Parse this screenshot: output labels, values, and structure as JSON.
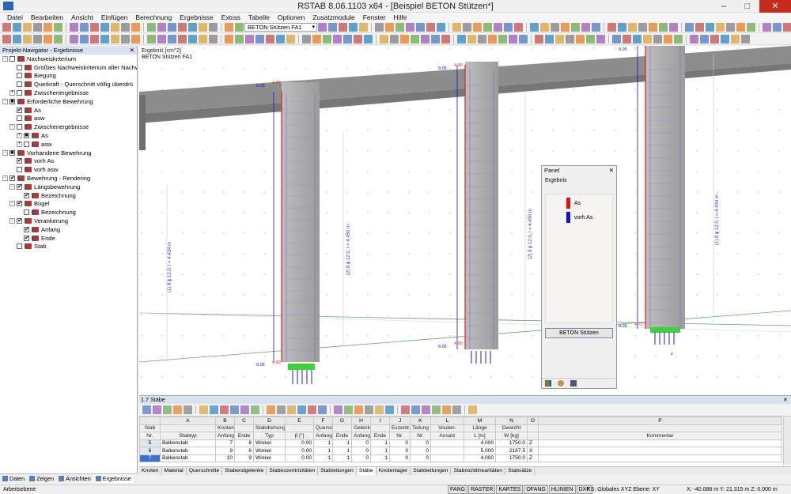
{
  "window": {
    "title": "RSTAB 8.06.1103 x64 - [Beispiel BETON Stützen*]",
    "min": "–",
    "max": "□",
    "close": "✕"
  },
  "menu": [
    "Datei",
    "Bearbeiten",
    "Ansicht",
    "Einfügen",
    "Berechnung",
    "Ergebnisse",
    "Extras",
    "Tabelle",
    "Optionen",
    "Zusatzmodule",
    "Fenster",
    "Hilfe"
  ],
  "toolbar": {
    "case_combo": "BETON Stützen FA1"
  },
  "navigator": {
    "title": "Projekt-Navigator - Ergebnisse",
    "close": "✕",
    "items": [
      {
        "label": "Nachweiskriterium",
        "level": 0,
        "expand": "-",
        "check": "",
        "icon": true
      },
      {
        "label": "Größtes Nachweiskriterium aller Nachw",
        "level": 1,
        "expand": "",
        "check": "",
        "icon": true
      },
      {
        "label": "Biegung",
        "level": 1,
        "expand": "",
        "check": "",
        "icon": true
      },
      {
        "label": "Querkraft - Querschnitt völlig überdrü",
        "level": 1,
        "expand": "",
        "check": "",
        "icon": true
      },
      {
        "label": "Zwischenergebnisse",
        "level": 1,
        "expand": "+",
        "check": "",
        "icon": true
      },
      {
        "label": "Erforderliche Bewehrung",
        "level": 0,
        "expand": "-",
        "check": "■",
        "icon": true
      },
      {
        "label": "As",
        "level": 1,
        "expand": "",
        "check": "✔",
        "icon": true
      },
      {
        "label": "asw",
        "level": 1,
        "expand": "",
        "check": "",
        "icon": true
      },
      {
        "label": "Zwischenergebnisse",
        "level": 1,
        "expand": "-",
        "check": "",
        "icon": true
      },
      {
        "label": "As",
        "level": 2,
        "expand": "+",
        "check": "■",
        "icon": true
      },
      {
        "label": "asw",
        "level": 2,
        "expand": "+",
        "check": "",
        "icon": true
      },
      {
        "label": "Vorhandene Bewehrung",
        "level": 0,
        "expand": "-",
        "check": "■",
        "icon": true
      },
      {
        "label": "vorh As",
        "level": 1,
        "expand": "",
        "check": "✔",
        "icon": true
      },
      {
        "label": "vorh asw",
        "level": 1,
        "expand": "",
        "check": "",
        "icon": true
      },
      {
        "label": "Bewehrung - Rendering",
        "level": 0,
        "expand": "-",
        "check": "✔",
        "icon": true
      },
      {
        "label": "Längsbewehrung",
        "level": 1,
        "expand": "-",
        "check": "✔",
        "icon": true
      },
      {
        "label": "Bezeichnung",
        "level": 2,
        "expand": "",
        "check": "✔",
        "icon": true
      },
      {
        "label": "Bügel",
        "level": 1,
        "expand": "-",
        "check": "✔",
        "icon": true
      },
      {
        "label": "Bezeichnung",
        "level": 2,
        "expand": "",
        "check": "",
        "icon": true
      },
      {
        "label": "Verankerung",
        "level": 1,
        "expand": "-",
        "check": "✔",
        "icon": true
      },
      {
        "label": "Anfang",
        "level": 2,
        "expand": "",
        "check": "✔",
        "icon": true
      },
      {
        "label": "Ende",
        "level": 2,
        "expand": "",
        "check": "✔",
        "icon": true
      },
      {
        "label": "Stab",
        "level": 1,
        "expand": "",
        "check": "",
        "icon": true
      }
    ],
    "tabs": [
      "Daten",
      "Zeigen",
      "Ansichten",
      "Ergebnisse"
    ]
  },
  "view": {
    "caption1": "Ergebnis [cm^2]",
    "caption2": "BETON Stützen FA1",
    "labels": {
      "v905": "9.05",
      "v490": "4.90",
      "v472": "4.72",
      "bar_left": "(1) 8 ϕ 12.0, l = 4.434 m",
      "bar_mid": "(2) 8 ϕ 12.0, l = 4.450 m",
      "bar_right": "(1) 8 ϕ 12.0, l = 4.434 m",
      "axis_z": "z"
    }
  },
  "panel": {
    "title": "Panel",
    "close": "✕",
    "subtitle": "Ergebnis",
    "legend": [
      {
        "label": "As",
        "color": "#e01010"
      },
      {
        "label": "vorh As",
        "color": "#1010d0"
      }
    ],
    "button": "BETON Stützen"
  },
  "table": {
    "title": "1.7 Stäbe",
    "close": "✕",
    "letters": [
      "",
      "A",
      "B",
      "C",
      "D",
      "E",
      "F",
      "G",
      "H",
      "I",
      "J",
      "K",
      "L",
      "M",
      "N",
      "O",
      "P"
    ],
    "head1": [
      "Stab",
      "",
      "Knoten Nr.",
      "",
      "Stabdrehung",
      "",
      "Querschnitt Nr.",
      "",
      "Gelenk Nr.",
      "",
      "Exzentr.",
      "Teilung",
      "Vouten-",
      "Länge",
      "Gewicht",
      "",
      ""
    ],
    "head2": [
      "Nr.",
      "Stabtyp",
      "Anfang",
      "Ende",
      "Typ",
      "β [°]",
      "Anfang",
      "Ende",
      "Anfang",
      "Ende",
      "Nr.",
      "Nr.",
      "Ansatz",
      "L [m]",
      "W [kg]",
      "",
      "Kommentar"
    ],
    "rows": [
      [
        "5",
        "Balkenstab",
        "7",
        "6",
        "Winkel",
        "0.00",
        "1",
        "1",
        "0",
        "1",
        "0",
        "0",
        "",
        "4.000",
        "1750.0",
        "Z",
        ""
      ],
      [
        "6",
        "Balkenstab",
        "9",
        "6",
        "Winkel",
        "0.00",
        "1",
        "1",
        "0",
        "1",
        "0",
        "0",
        "",
        "5.000",
        "2187.5",
        "X",
        ""
      ],
      [
        "7",
        "Balkenstab",
        "10",
        "9",
        "Winkel",
        "0.00",
        "1",
        "1",
        "0",
        "1",
        "0",
        "0",
        "",
        "4.000",
        "1750.0",
        "Z",
        ""
      ]
    ],
    "tabs": [
      "Knoten",
      "Material",
      "Querschnitte",
      "Stabendgelenke",
      "Stabexzentrizitäten",
      "Stabteilungen",
      "Stäbe",
      "Knotenlager",
      "Stabbettungen",
      "Stabnichtlinearitäten",
      "Stabsätze"
    ],
    "active_tab": "Stäbe"
  },
  "status": {
    "left": "Arbeitsebene",
    "buttons": [
      "FANG",
      "RASTER",
      "KARTES",
      "OFANG",
      "HLINIEN",
      "DXF"
    ],
    "cs": "KS: Globales XYZ  Ebene: XY",
    "xy": "X:  -40.088 m   Y:  21.315 m   Z:  0.000 m"
  }
}
